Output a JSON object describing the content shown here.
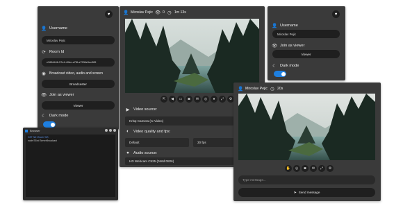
{
  "settings_left": {
    "username_label": "Username",
    "username_value": "Miroslav Pejic",
    "room_label": "Room Id",
    "room_value": "e3684446-57e4-40de-a7f8-a7536e5ec385",
    "broadcast_label": "Broadcast video, audio and screen",
    "broadcaster_button": "Broadcaster",
    "join_label": "Join as viewer",
    "viewer_button": "Viewer",
    "dark_mode_label": "Dark mode",
    "dark_mode_on": true
  },
  "settings_right": {
    "username_label": "Username",
    "username_value": "Miroslav Pejic",
    "join_label": "Join as viewer",
    "viewer_button": "Viewer",
    "dark_mode_label": "Dark mode",
    "dark_mode_on": true
  },
  "broadcaster": {
    "user": "Miroslav Pejic",
    "viewers": "0",
    "duration": "1m 13s",
    "video_source_label": "Video source:",
    "video_source_value": "Krisp Camera (rx Video)",
    "quality_label": "Video quality and fps:",
    "quality_value": "Default",
    "fps_value": "30 fps",
    "audio_source_label": "Audio source:",
    "audio_source_value": "HD Webcam C525 (046d:0826)"
  },
  "viewer": {
    "user": "Miroslav Pejic",
    "duration": "20s",
    "message_placeholder": "Type message...",
    "send_button": "Send message"
  },
  "terminal": {
    "title": "Browser",
    "line1": "GET ND  Viewer WS",
    "line2": "node SEnd ServerBroadcast"
  },
  "colors": {
    "panel": "#3a3a3a",
    "field": "#1f1f1f",
    "toggle_on": "#1e7fe0"
  }
}
